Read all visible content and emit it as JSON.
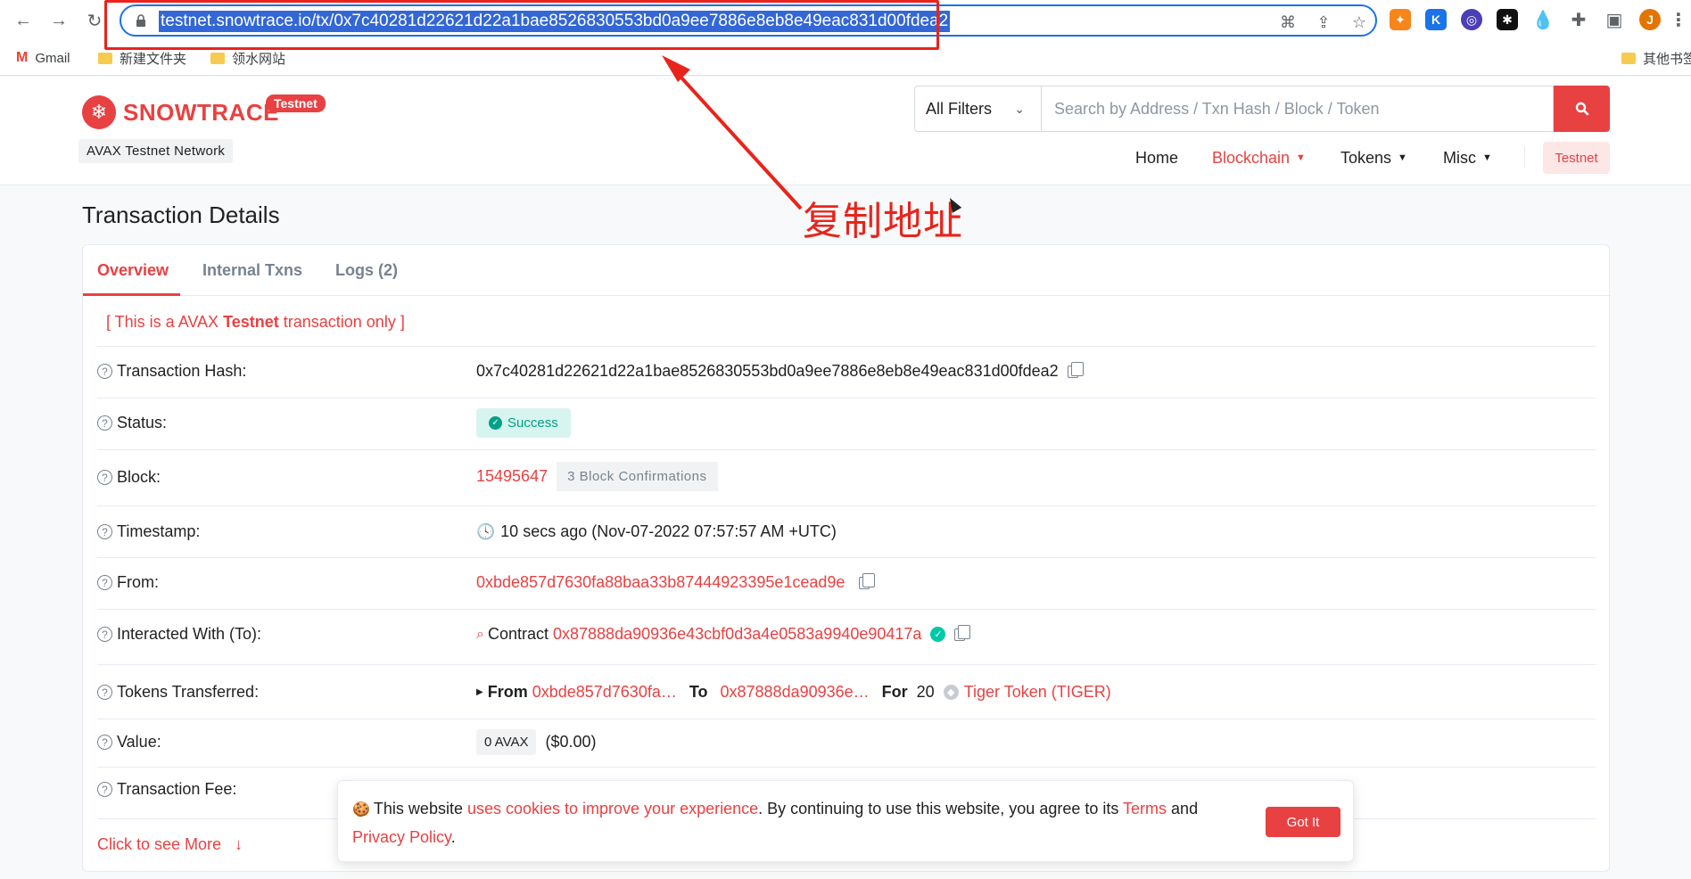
{
  "browser": {
    "url": "testnet.snowtrace.io/tx/0x7c40281d22621d22a1bae8526830553bd0a9ee7886e8eb8e49eac831d00fdea2",
    "profile_initial": "J",
    "bookmarks": [
      "Gmail",
      "新建文件夹",
      "领水网站"
    ],
    "other_bookmarks": "其他书签"
  },
  "annotation": {
    "text": "复制地址",
    "color": "#e8241c"
  },
  "header": {
    "logo_text": "SNOWTRACE",
    "badge": "Testnet",
    "network": "AVAX Testnet Network",
    "filter_label": "All Filters",
    "search_placeholder": "Search by Address / Txn Hash / Block / Token",
    "nav": {
      "home": "Home",
      "blockchain": "Blockchain",
      "tokens": "Tokens",
      "misc": "Misc",
      "testnet": "Testnet"
    },
    "accent_color": "#e84142"
  },
  "page": {
    "title": "Transaction Details",
    "tabs": [
      "Overview",
      "Internal Txns",
      "Logs (2)"
    ],
    "notice": {
      "before": "[ This is a AVAX ",
      "bold": "Testnet",
      "after": " transaction only ]"
    },
    "rows": {
      "hash": {
        "label": "Transaction Hash:",
        "value": "0x7c40281d22621d22a1bae8526830553bd0a9ee7886e8eb8e49eac831d00fdea2"
      },
      "status": {
        "label": "Status:",
        "value": "Success"
      },
      "block": {
        "label": "Block:",
        "value": "15495647",
        "confirmations": "3 Block Confirmations"
      },
      "timestamp": {
        "label": "Timestamp:",
        "value": "10 secs ago (Nov-07-2022 07:57:57 AM +UTC)"
      },
      "from": {
        "label": "From:",
        "value": "0xbde857d7630fa88baa33b87444923395e1cead9e"
      },
      "to": {
        "label": "Interacted With (To):",
        "prefix": "Contract",
        "value": "0x87888da90936e43cbf0d3a4e0583a9940e90417a"
      },
      "tokens": {
        "label": "Tokens Transferred:",
        "from_label": "From",
        "from": "0xbde857d7630fa…",
        "to_label": "To",
        "to": "0x87888da90936e…",
        "for_label": "For",
        "amount": "20",
        "token": "Tiger Token (TIGER)"
      },
      "value": {
        "label": "Value:",
        "amount": "0 AVAX",
        "usd": "($0.00)"
      },
      "fee": {
        "label": "Transaction Fee:"
      }
    },
    "more_link": "Click to see More"
  },
  "cookie": {
    "t1": "This website ",
    "link1": "uses cookies to improve your experience",
    "t2": ". By continuing to use this website, you agree to its ",
    "link2": "Terms",
    "t3": " and ",
    "link3": "Privacy Policy",
    "t4": ".",
    "button": "Got It"
  }
}
